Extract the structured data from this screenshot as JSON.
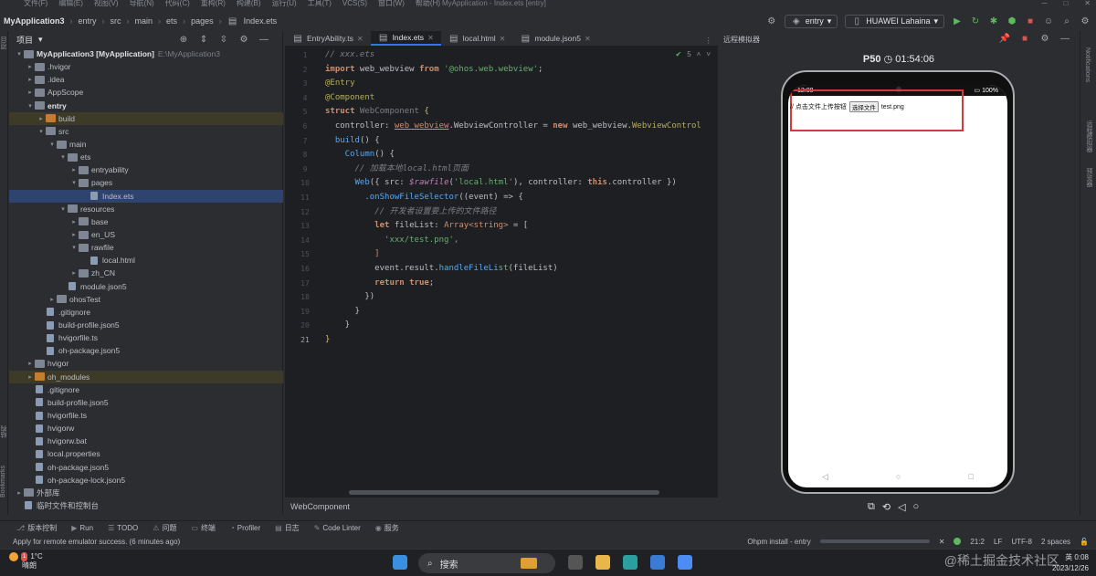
{
  "menubar": {
    "items": [
      "文件(F)",
      "编辑(E)",
      "视图(V)",
      "导航(N)",
      "代码(C)",
      "重构(R)",
      "构建(B)",
      "运行(U)",
      "工具(T)",
      "VCS(S)",
      "窗口(W)",
      "帮助(H)"
    ],
    "title": "MyApplication - Index.ets [entry]"
  },
  "toolbar": {
    "breadcrumb": [
      "MyApplication3",
      "entry",
      "src",
      "main",
      "ets",
      "pages",
      "Index.ets"
    ],
    "module_combo": "entry",
    "device_combo": "HUAWEI Lahaina"
  },
  "project": {
    "header": "项目",
    "tree": [
      {
        "label": "MyApplication3 [MyApplication]",
        "extra": "E:\\MyApplication3",
        "depth": 0,
        "type": "folder",
        "open": true,
        "bold": true
      },
      {
        "label": ".hvigor",
        "depth": 1,
        "type": "folder",
        "open": false
      },
      {
        "label": ".idea",
        "depth": 1,
        "type": "folder",
        "open": false
      },
      {
        "label": "AppScope",
        "depth": 1,
        "type": "folder",
        "open": false
      },
      {
        "label": "entry",
        "depth": 1,
        "type": "folder",
        "open": true,
        "bold": true
      },
      {
        "label": "build",
        "depth": 2,
        "type": "folder-orange",
        "open": false,
        "state": "mod"
      },
      {
        "label": "src",
        "depth": 2,
        "type": "folder",
        "open": true
      },
      {
        "label": "main",
        "depth": 3,
        "type": "folder",
        "open": true
      },
      {
        "label": "ets",
        "depth": 4,
        "type": "folder",
        "open": true
      },
      {
        "label": "entryability",
        "depth": 5,
        "type": "folder",
        "open": false
      },
      {
        "label": "pages",
        "depth": 5,
        "type": "folder",
        "open": true
      },
      {
        "label": "Index.ets",
        "depth": 6,
        "type": "file",
        "state": "sel"
      },
      {
        "label": "resources",
        "depth": 4,
        "type": "folder",
        "open": true
      },
      {
        "label": "base",
        "depth": 5,
        "type": "folder",
        "open": false
      },
      {
        "label": "en_US",
        "depth": 5,
        "type": "folder",
        "open": false
      },
      {
        "label": "rawfile",
        "depth": 5,
        "type": "folder",
        "open": true
      },
      {
        "label": "local.html",
        "depth": 6,
        "type": "file"
      },
      {
        "label": "zh_CN",
        "depth": 5,
        "type": "folder",
        "open": false
      },
      {
        "label": "module.json5",
        "depth": 4,
        "type": "file"
      },
      {
        "label": "ohosTest",
        "depth": 3,
        "type": "folder",
        "open": false
      },
      {
        "label": ".gitignore",
        "depth": 2,
        "type": "file"
      },
      {
        "label": "build-profile.json5",
        "depth": 2,
        "type": "file"
      },
      {
        "label": "hvigorfile.ts",
        "depth": 2,
        "type": "file"
      },
      {
        "label": "oh-package.json5",
        "depth": 2,
        "type": "file"
      },
      {
        "label": "hvigor",
        "depth": 1,
        "type": "folder",
        "open": false
      },
      {
        "label": "oh_modules",
        "depth": 1,
        "type": "folder-orange",
        "open": false,
        "state": "mod"
      },
      {
        "label": ".gitignore",
        "depth": 1,
        "type": "file"
      },
      {
        "label": "build-profile.json5",
        "depth": 1,
        "type": "file"
      },
      {
        "label": "hvigorfile.ts",
        "depth": 1,
        "type": "file"
      },
      {
        "label": "hvigorw",
        "depth": 1,
        "type": "file"
      },
      {
        "label": "hvigorw.bat",
        "depth": 1,
        "type": "file"
      },
      {
        "label": "local.properties",
        "depth": 1,
        "type": "file"
      },
      {
        "label": "oh-package.json5",
        "depth": 1,
        "type": "file"
      },
      {
        "label": "oh-package-lock.json5",
        "depth": 1,
        "type": "file"
      },
      {
        "label": "外部库",
        "depth": 0,
        "type": "folder",
        "open": false
      },
      {
        "label": "临时文件和控制台",
        "depth": 0,
        "type": "file"
      }
    ]
  },
  "editor": {
    "tabs": [
      {
        "label": "EntryAbility.ts",
        "active": false
      },
      {
        "label": "Index.ets",
        "active": true
      },
      {
        "label": "local.html",
        "active": false
      },
      {
        "label": "module.json5",
        "active": false
      }
    ],
    "inlay_count": "5",
    "line_numbers": [
      "1",
      "2",
      "3",
      "4",
      "5",
      "6",
      "7",
      "8",
      "9",
      "10",
      "11",
      "12",
      "13",
      "14",
      "15",
      "16",
      "17",
      "18",
      "19",
      "20",
      "21"
    ],
    "breadcrumb_bottom": "WebComponent",
    "code": {
      "l1": "// xxx.ets",
      "l2_import": "import",
      "l2_name": " web_webview ",
      "l2_from": "from",
      "l2_str": "'@ohos.web.webview'",
      "l3": "@Entry",
      "l4": "@Component",
      "l5_kw": "struct",
      "l5_name": " WebComponent ",
      "l5_brace": "{",
      "l6_a": "  controller: ",
      "l6_b": "web_webview",
      "l6_c": ".WebviewController = ",
      "l6_new": "new",
      "l6_d": " web_webview.",
      "l6_e": "WebviewControl",
      "l7_fn": "  build",
      "l7_rest": "() {",
      "l8_fn": "    Column",
      "l8_rest": "() {",
      "l9": "      // 加载本地local.html页面",
      "l10_fn": "      Web",
      "l10_a": "({ src: ",
      "l10_raw": "$rawfile",
      "l10_b": "(",
      "l10_str": "'local.html'",
      "l10_c": "), controller: ",
      "l10_this": "this",
      "l10_d": ".controller })",
      "l11_fn": "        .onShowFileSelector",
      "l11_rest": "((event) => {",
      "l12": "          // 开发者设置要上传的文件路径",
      "l13_let": "          let",
      "l13_a": " fileList: ",
      "l13_ty": "Array<string>",
      "l13_b": " = [",
      "l14": "            'xxx/test.png',",
      "l15": "          ]",
      "l16_a": "          event.result.",
      "l16_fn": "handleFileList",
      "l16_b": "(fileList)",
      "l17_kw": "          return",
      "l17_val": " true",
      "l17_end": ";",
      "l18": "        })",
      "l19": "      }",
      "l20": "    }",
      "l21": "}"
    }
  },
  "emulator": {
    "title": "远程模拟器",
    "model": "P50",
    "timer": "01:54:06",
    "status_time": "12:08",
    "battery": "100%",
    "web_text": "// 点击文件上传按钮",
    "choose_button": "选择文件",
    "file_name": "test.png"
  },
  "right_stripe": [
    "Notifications",
    "远程模拟器",
    "预览器"
  ],
  "left_stripe": [
    "项目",
    "结构",
    "Bookmarks"
  ],
  "tool_windows": [
    "版本控制",
    "Run",
    "TODO",
    "问题",
    "终端",
    "Profiler",
    "日志",
    "Code Linter",
    "服务"
  ],
  "status": {
    "message": "Apply for remote emulator success. (6 minutes ago)",
    "task": "Ohpm install - entry",
    "position": "21:2",
    "line_sep": "LF",
    "encoding": "UTF-8",
    "indent": "2 spaces"
  },
  "taskbar": {
    "temp": "1°C",
    "weather": "晴朗",
    "badge": "1",
    "search": "搜索",
    "ime": "英",
    "time": "0:08",
    "date": "2023/12/26",
    "watermark": "@稀土掘金技术社区"
  }
}
